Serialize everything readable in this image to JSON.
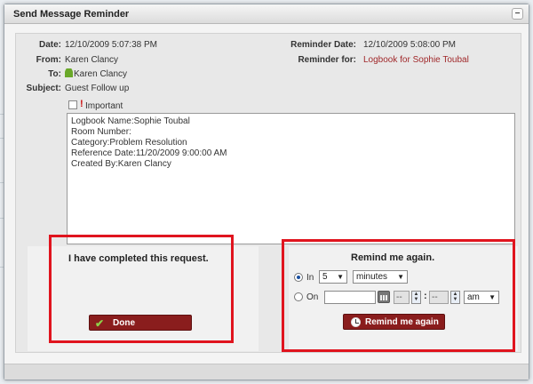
{
  "dialog": {
    "title": "Send Message Reminder",
    "minimize_symbol": "−"
  },
  "fields": {
    "date_label": "Date:",
    "date_value": "12/10/2009 5:07:38 PM",
    "from_label": "From:",
    "from_value": "Karen Clancy",
    "to_label": "To:",
    "to_value": "Karen Clancy",
    "subject_label": "Subject:",
    "subject_value": "Guest Follow up",
    "reminder_date_label": "Reminder Date:",
    "reminder_date_value": "12/10/2009 5:08:00 PM",
    "reminder_for_label": "Reminder for:",
    "reminder_for_value": "Logbook for Sophie Toubal"
  },
  "important": {
    "checked": false,
    "icon_glyph": "!",
    "label": "Important"
  },
  "message": {
    "lines": [
      "Logbook Name:Sophie Toubal",
      "Room Number:",
      "Category:Problem Resolution",
      "Reference Date:11/20/2009 9:00:00 AM",
      "Created By:Karen Clancy"
    ]
  },
  "complete": {
    "heading": "I have completed this request.",
    "button_label": "Done"
  },
  "remind": {
    "heading": "Remind me again.",
    "option_in_label": "In",
    "option_on_label": "On",
    "selected_option": "in",
    "in_amount": "5",
    "in_unit": "minutes",
    "on_date": "",
    "on_hour": "--",
    "on_minute": "--",
    "on_ampm": "am",
    "time_separator": ":",
    "button_label": "Remind me again"
  },
  "icons": {
    "person": "person-icon",
    "important": "exclamation-icon",
    "done": "checkmark-icon",
    "calendar": "calendar-icon",
    "remind": "clock-icon"
  },
  "colors": {
    "button_bg": "#8a1d1d",
    "link": "#a0282a",
    "highlight": "#e0141e"
  }
}
